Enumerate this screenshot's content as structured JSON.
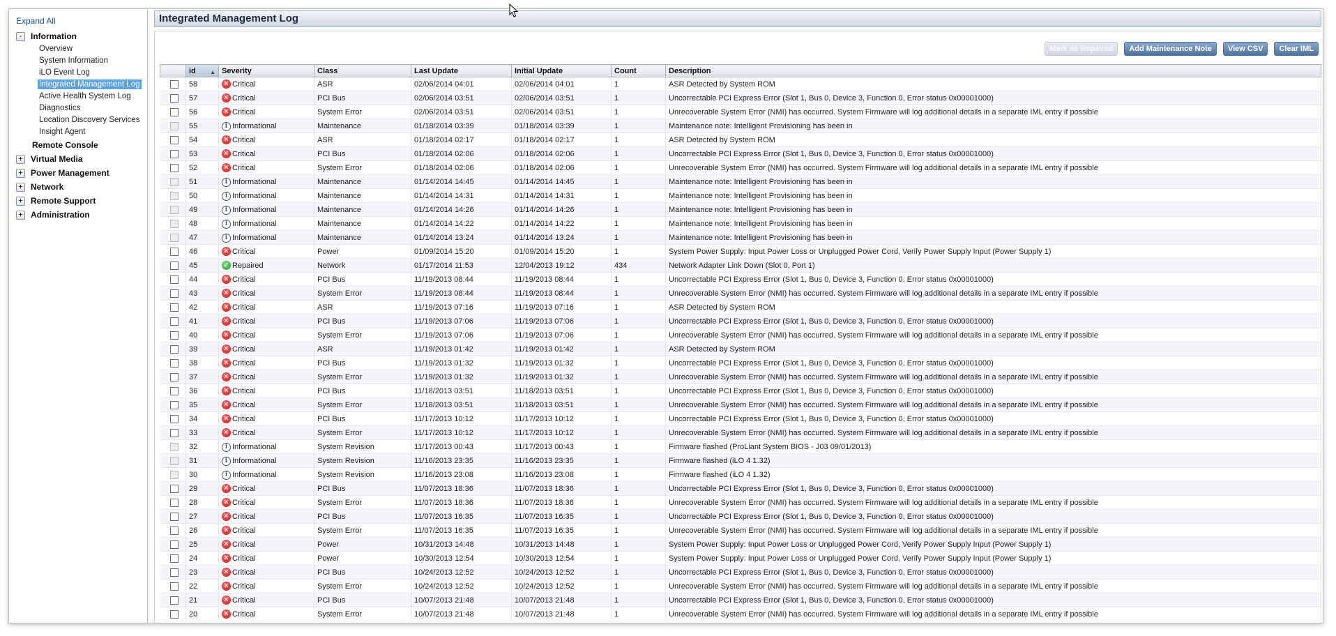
{
  "sidebar": {
    "expand_all": "Expand All",
    "information": {
      "label": "Information",
      "toggle": "-",
      "items": [
        "Overview",
        "System Information",
        "iLO Event Log",
        "Integrated Management Log",
        "Active Health System Log",
        "Diagnostics",
        "Location Discovery Services",
        "Insight Agent"
      ]
    },
    "remote_console": "Remote Console",
    "sections": [
      {
        "label": "Virtual Media",
        "toggle": "+"
      },
      {
        "label": "Power Management",
        "toggle": "+"
      },
      {
        "label": "Network",
        "toggle": "+"
      },
      {
        "label": "Remote Support",
        "toggle": "+"
      },
      {
        "label": "Administration",
        "toggle": "+"
      }
    ]
  },
  "page": {
    "title": "Integrated Management Log"
  },
  "toolbar": {
    "mark_repaired": "Mark as Repaired",
    "add_note": "Add Maintenance Note",
    "view_csv": "View CSV",
    "clear_iml": "Clear IML"
  },
  "table": {
    "columns": {
      "id": "id",
      "severity": "Severity",
      "class": "Class",
      "last_update": "Last Update",
      "initial_update": "Initial Update",
      "count": "Count",
      "description": "Description"
    },
    "sort_indicator": "▲",
    "rows": [
      {
        "id": "58",
        "severity": "Critical",
        "class": "ASR",
        "last": "02/06/2014 04:01",
        "initial": "02/06/2014 04:01",
        "count": "1",
        "desc": "ASR Detected by System ROM"
      },
      {
        "id": "57",
        "severity": "Critical",
        "class": "PCI Bus",
        "last": "02/06/2014 03:51",
        "initial": "02/06/2014 03:51",
        "count": "1",
        "desc": "Uncorrectable PCI Express Error (Slot 1, Bus 0, Device 3, Function 0, Error status 0x00001000)"
      },
      {
        "id": "56",
        "severity": "Critical",
        "class": "System Error",
        "last": "02/06/2014 03:51",
        "initial": "02/06/2014 03:51",
        "count": "1",
        "desc": "Unrecoverable System Error (NMI) has occurred. System Firmware will log additional details in a separate IML entry if possible"
      },
      {
        "id": "55",
        "severity": "Informational",
        "class": "Maintenance",
        "last": "01/18/2014 03:39",
        "initial": "01/18/2014 03:39",
        "count": "1",
        "desc": "Maintenance note: Intelligent Provisioning has been in"
      },
      {
        "id": "54",
        "severity": "Critical",
        "class": "ASR",
        "last": "01/18/2014 02:17",
        "initial": "01/18/2014 02:17",
        "count": "1",
        "desc": "ASR Detected by System ROM"
      },
      {
        "id": "53",
        "severity": "Critical",
        "class": "PCI Bus",
        "last": "01/18/2014 02:06",
        "initial": "01/18/2014 02:06",
        "count": "1",
        "desc": "Uncorrectable PCI Express Error (Slot 1, Bus 0, Device 3, Function 0, Error status 0x00001000)"
      },
      {
        "id": "52",
        "severity": "Critical",
        "class": "System Error",
        "last": "01/18/2014 02:06",
        "initial": "01/18/2014 02:06",
        "count": "1",
        "desc": "Unrecoverable System Error (NMI) has occurred. System Firmware will log additional details in a separate IML entry if possible"
      },
      {
        "id": "51",
        "severity": "Informational",
        "class": "Maintenance",
        "last": "01/14/2014 14:45",
        "initial": "01/14/2014 14:45",
        "count": "1",
        "desc": "Maintenance note: Intelligent Provisioning has been in"
      },
      {
        "id": "50",
        "severity": "Informational",
        "class": "Maintenance",
        "last": "01/14/2014 14:31",
        "initial": "01/14/2014 14:31",
        "count": "1",
        "desc": "Maintenance note: Intelligent Provisioning has been in"
      },
      {
        "id": "49",
        "severity": "Informational",
        "class": "Maintenance",
        "last": "01/14/2014 14:26",
        "initial": "01/14/2014 14:26",
        "count": "1",
        "desc": "Maintenance note: Intelligent Provisioning has been in"
      },
      {
        "id": "48",
        "severity": "Informational",
        "class": "Maintenance",
        "last": "01/14/2014 14:22",
        "initial": "01/14/2014 14:22",
        "count": "1",
        "desc": "Maintenance note: Intelligent Provisioning has been in"
      },
      {
        "id": "47",
        "severity": "Informational",
        "class": "Maintenance",
        "last": "01/14/2014 13:24",
        "initial": "01/14/2014 13:24",
        "count": "1",
        "desc": "Maintenance note: Intelligent Provisioning has been in"
      },
      {
        "id": "46",
        "severity": "Critical",
        "class": "Power",
        "last": "01/09/2014 15:20",
        "initial": "01/09/2014 15:20",
        "count": "1",
        "desc": "System Power Supply: Input Power Loss or Unplugged Power Cord, Verify Power Supply Input (Power Supply 1)"
      },
      {
        "id": "45",
        "severity": "Repaired",
        "class": "Network",
        "last": "01/17/2014 11:53",
        "initial": "12/04/2013 19:12",
        "count": "434",
        "desc": "Network Adapter Link Down (Slot 0, Port 1)"
      },
      {
        "id": "44",
        "severity": "Critical",
        "class": "PCI Bus",
        "last": "11/19/2013 08:44",
        "initial": "11/19/2013 08:44",
        "count": "1",
        "desc": "Uncorrectable PCI Express Error (Slot 1, Bus 0, Device 3, Function 0, Error status 0x00001000)"
      },
      {
        "id": "43",
        "severity": "Critical",
        "class": "System Error",
        "last": "11/19/2013 08:44",
        "initial": "11/19/2013 08:44",
        "count": "1",
        "desc": "Unrecoverable System Error (NMI) has occurred. System Firmware will log additional details in a separate IML entry if possible"
      },
      {
        "id": "42",
        "severity": "Critical",
        "class": "ASR",
        "last": "11/19/2013 07:16",
        "initial": "11/19/2013 07:16",
        "count": "1",
        "desc": "ASR Detected by System ROM"
      },
      {
        "id": "41",
        "severity": "Critical",
        "class": "PCI Bus",
        "last": "11/19/2013 07:06",
        "initial": "11/19/2013 07:06",
        "count": "1",
        "desc": "Uncorrectable PCI Express Error (Slot 1, Bus 0, Device 3, Function 0, Error status 0x00001000)"
      },
      {
        "id": "40",
        "severity": "Critical",
        "class": "System Error",
        "last": "11/19/2013 07:06",
        "initial": "11/19/2013 07:06",
        "count": "1",
        "desc": "Unrecoverable System Error (NMI) has occurred. System Firmware will log additional details in a separate IML entry if possible"
      },
      {
        "id": "39",
        "severity": "Critical",
        "class": "ASR",
        "last": "11/19/2013 01:42",
        "initial": "11/19/2013 01:42",
        "count": "1",
        "desc": "ASR Detected by System ROM"
      },
      {
        "id": "38",
        "severity": "Critical",
        "class": "PCI Bus",
        "last": "11/19/2013 01:32",
        "initial": "11/19/2013 01:32",
        "count": "1",
        "desc": "Uncorrectable PCI Express Error (Slot 1, Bus 0, Device 3, Function 0, Error status 0x00001000)"
      },
      {
        "id": "37",
        "severity": "Critical",
        "class": "System Error",
        "last": "11/19/2013 01:32",
        "initial": "11/19/2013 01:32",
        "count": "1",
        "desc": "Unrecoverable System Error (NMI) has occurred. System Firmware will log additional details in a separate IML entry if possible"
      },
      {
        "id": "36",
        "severity": "Critical",
        "class": "PCI Bus",
        "last": "11/18/2013 03:51",
        "initial": "11/18/2013 03:51",
        "count": "1",
        "desc": "Uncorrectable PCI Express Error (Slot 1, Bus 0, Device 3, Function 0, Error status 0x00001000)"
      },
      {
        "id": "35",
        "severity": "Critical",
        "class": "System Error",
        "last": "11/18/2013 03:51",
        "initial": "11/18/2013 03:51",
        "count": "1",
        "desc": "Unrecoverable System Error (NMI) has occurred. System Firmware will log additional details in a separate IML entry if possible"
      },
      {
        "id": "34",
        "severity": "Critical",
        "class": "PCI Bus",
        "last": "11/17/2013 10:12",
        "initial": "11/17/2013 10:12",
        "count": "1",
        "desc": "Uncorrectable PCI Express Error (Slot 1, Bus 0, Device 3, Function 0, Error status 0x00001000)"
      },
      {
        "id": "33",
        "severity": "Critical",
        "class": "System Error",
        "last": "11/17/2013 10:12",
        "initial": "11/17/2013 10:12",
        "count": "1",
        "desc": "Unrecoverable System Error (NMI) has occurred. System Firmware will log additional details in a separate IML entry if possible"
      },
      {
        "id": "32",
        "severity": "Informational",
        "class": "System Revision",
        "last": "11/17/2013 00:43",
        "initial": "11/17/2013 00:43",
        "count": "1",
        "desc": "Firmware flashed (ProLiant System BIOS - J03 09/01/2013)"
      },
      {
        "id": "31",
        "severity": "Informational",
        "class": "System Revision",
        "last": "11/16/2013 23:35",
        "initial": "11/16/2013 23:35",
        "count": "1",
        "desc": "Firmware flashed (iLO 4 1.32)"
      },
      {
        "id": "30",
        "severity": "Informational",
        "class": "System Revision",
        "last": "11/16/2013 23:08",
        "initial": "11/16/2013 23:08",
        "count": "1",
        "desc": "Firmware flashed (iLO 4 1.32)"
      },
      {
        "id": "29",
        "severity": "Critical",
        "class": "PCI Bus",
        "last": "11/07/2013 18:36",
        "initial": "11/07/2013 18:36",
        "count": "1",
        "desc": "Uncorrectable PCI Express Error (Slot 1, Bus 0, Device 3, Function 0, Error status 0x00001000)"
      },
      {
        "id": "28",
        "severity": "Critical",
        "class": "System Error",
        "last": "11/07/2013 18:36",
        "initial": "11/07/2013 18:36",
        "count": "1",
        "desc": "Unrecoverable System Error (NMI) has occurred. System Firmware will log additional details in a separate IML entry if possible"
      },
      {
        "id": "27",
        "severity": "Critical",
        "class": "PCI Bus",
        "last": "11/07/2013 16:35",
        "initial": "11/07/2013 16:35",
        "count": "1",
        "desc": "Uncorrectable PCI Express Error (Slot 1, Bus 0, Device 3, Function 0, Error status 0x00001000)"
      },
      {
        "id": "26",
        "severity": "Critical",
        "class": "System Error",
        "last": "11/07/2013 16:35",
        "initial": "11/07/2013 16:35",
        "count": "1",
        "desc": "Unrecoverable System Error (NMI) has occurred. System Firmware will log additional details in a separate IML entry if possible"
      },
      {
        "id": "25",
        "severity": "Critical",
        "class": "Power",
        "last": "10/31/2013 14:48",
        "initial": "10/31/2013 14:48",
        "count": "1",
        "desc": "System Power Supply: Input Power Loss or Unplugged Power Cord, Verify Power Supply Input (Power Supply 1)"
      },
      {
        "id": "24",
        "severity": "Critical",
        "class": "Power",
        "last": "10/30/2013 12:54",
        "initial": "10/30/2013 12:54",
        "count": "1",
        "desc": "System Power Supply: Input Power Loss or Unplugged Power Cord, Verify Power Supply Input (Power Supply 1)"
      },
      {
        "id": "23",
        "severity": "Critical",
        "class": "PCI Bus",
        "last": "10/24/2013 12:52",
        "initial": "10/24/2013 12:52",
        "count": "1",
        "desc": "Uncorrectable PCI Express Error (Slot 1, Bus 0, Device 3, Function 0, Error status 0x00001000)"
      },
      {
        "id": "22",
        "severity": "Critical",
        "class": "System Error",
        "last": "10/24/2013 12:52",
        "initial": "10/24/2013 12:52",
        "count": "1",
        "desc": "Unrecoverable System Error (NMI) has occurred. System Firmware will log additional details in a separate IML entry if possible"
      },
      {
        "id": "21",
        "severity": "Critical",
        "class": "PCI Bus",
        "last": "10/07/2013 21:48",
        "initial": "10/07/2013 21:48",
        "count": "1",
        "desc": "Uncorrectable PCI Express Error (Slot 1, Bus 0, Device 3, Function 0, Error status 0x00001000)"
      },
      {
        "id": "20",
        "severity": "Critical",
        "class": "System Error",
        "last": "10/07/2013 21:48",
        "initial": "10/07/2013 21:48",
        "count": "1",
        "desc": "Unrecoverable System Error (NMI) has occurred. System Firmware will log additional details in a separate IML entry if possible"
      }
    ]
  },
  "icons": {
    "critical": "critical-x-icon",
    "informational": "info-i-icon",
    "repaired": "repaired-check-icon"
  },
  "colors": {
    "critical": "#d21818",
    "repaired": "#3aa83a",
    "selected_nav": "#5aa2e4",
    "button": "#5b7ea8"
  }
}
